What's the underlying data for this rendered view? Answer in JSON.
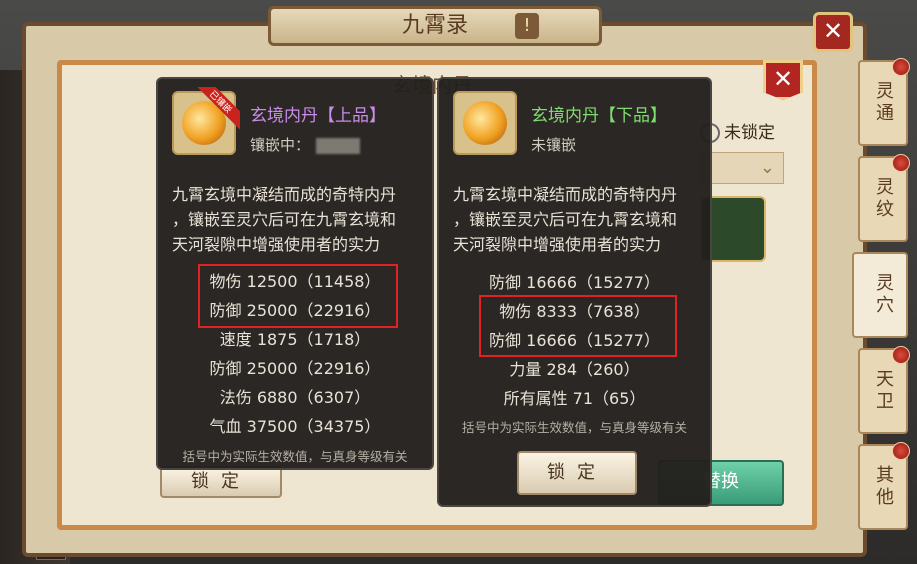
{
  "window": {
    "title": "九霄录",
    "title_badge": "!",
    "close": "✕"
  },
  "panel": {
    "title": "玄境内丹",
    "close": "✕"
  },
  "background": {
    "lock_status": "未锁定",
    "action_button": "替换",
    "left_lock_button": "锁定"
  },
  "side_tabs": [
    {
      "label": "灵通",
      "dot": true
    },
    {
      "label": "灵纹",
      "dot": true
    },
    {
      "label": "灵穴",
      "dot": false,
      "active": true
    },
    {
      "label": "天卫",
      "dot": true
    },
    {
      "label": "其他",
      "dot": true
    }
  ],
  "tooltip_left": {
    "name": "玄境内丹【上品】",
    "ribbon": "已镶嵌",
    "status": "镶嵌中：",
    "description": [
      "九霄玄境中凝结而成的奇特内丹",
      "，镶嵌至灵穴后可在九霄玄境和",
      "天河裂隙中增强使用者的实力"
    ],
    "stats": [
      "物伤 12500（11458）",
      "防御 25000（22916）",
      "速度 1875（1718）",
      "防御 25000（22916）",
      "法伤 6880（6307）",
      "气血 37500（34375）"
    ],
    "footnote": "括号中为实际生效数值，与真身等级有关"
  },
  "tooltip_right": {
    "name": "玄境内丹【下品】",
    "status": "未镶嵌",
    "description": [
      "九霄玄境中凝结而成的奇特内丹",
      "，镶嵌至灵穴后可在九霄玄境和",
      "天河裂隙中增强使用者的实力"
    ],
    "stats": [
      "防御 16666（15277）",
      "物伤 8333（7638）",
      "防御 16666（15277）",
      "力量 284（260）",
      "所有属性 71（65）"
    ],
    "footnote": "括号中为实际生效数值，与真身等级有关",
    "lock_button": "锁定"
  },
  "colors": {
    "highlight": "#e22222",
    "name_purple": "#c98ce8",
    "name_green": "#7fdd6f"
  }
}
